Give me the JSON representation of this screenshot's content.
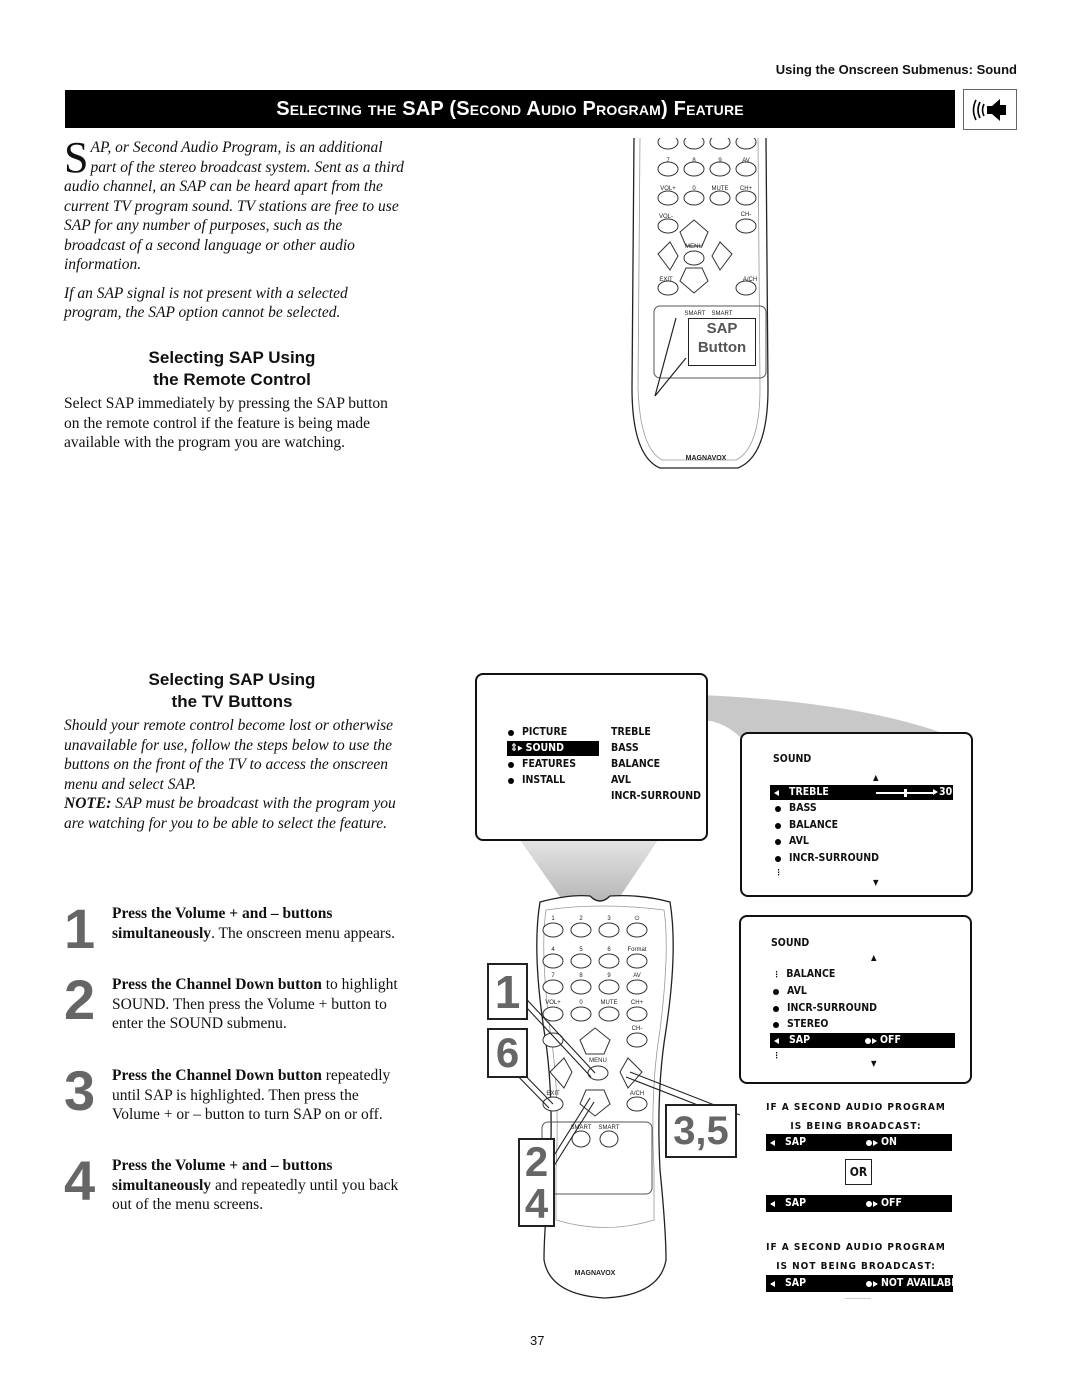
{
  "header": {
    "running_head": "Using the Onscreen Submenus: Sound",
    "title": "Selecting the SAP (Second Audio Program) Feature",
    "title_icon": "speaker-icon"
  },
  "intro": {
    "dropcap": "S",
    "paragraph1_rest": "AP, or Second Audio Program, is an additional part of the stereo broadcast system. Sent as a third audio channel, an SAP can be heard apart from the current TV program sound. TV stations are free to use SAP for any number of purposes, such as the broadcast of a second language or other audio information.",
    "paragraph2": "If an SAP signal is not present with a selected program, the SAP option cannot be selected."
  },
  "remote_section": {
    "heading_line1": "Selecting SAP Using",
    "heading_line2": "the Remote Control",
    "body": "Select SAP immediately by pressing the SAP button on the remote control if the feature is being made available with the program you are watching.",
    "callout_line1": "SAP",
    "callout_line2": "Button"
  },
  "tv_section": {
    "heading_line1": "Selecting SAP Using",
    "heading_line2": "the TV Buttons",
    "body": "Should your remote control become lost or otherwise unavailable for use, follow the steps below to use the buttons on the front of the TV to access the onscreen menu and select SAP.",
    "note_label": "NOTE:",
    "note_text": " SAP must be broadcast with the program you are watching for you to be able to select the feature."
  },
  "steps": [
    {
      "num": "1",
      "bold": "Press the Volume + and – buttons simultaneously",
      "rest": ". The onscreen menu appears."
    },
    {
      "num": "2",
      "bold": "Press the Channel Down button",
      "rest": " to highlight SOUND. Then press the Volume + button to enter the SOUND submenu."
    },
    {
      "num": "3",
      "bold": "Press the Channel Down button",
      "rest": " repeatedly until SAP is highlighted. Then press the Volume + or – button to turn SAP on or off."
    },
    {
      "num": "4",
      "bold": "Press the Volume + and – buttons simultaneously",
      "rest": " and repeatedly until you back out of the menu screens."
    }
  ],
  "main_menu": {
    "left_items": [
      "PICTURE",
      "SOUND",
      "FEATURES",
      "INSTALL"
    ],
    "highlighted": "SOUND",
    "right_items": [
      "TREBLE",
      "BASS",
      "BALANCE",
      "AVL",
      "INCR-SURROUND"
    ]
  },
  "sound_menu_1": {
    "title": "SOUND",
    "highlighted": "TREBLE",
    "treble_value": "30",
    "treble_level_fraction": 0.5,
    "items": [
      "BASS",
      "BALANCE",
      "AVL",
      "INCR-SURROUND"
    ]
  },
  "sound_menu_2": {
    "title": "SOUND",
    "items": [
      "BALANCE",
      "AVL",
      "INCR-SURROUND",
      "STEREO"
    ],
    "highlighted": "SAP",
    "highlighted_value": "OFF"
  },
  "sap_states": {
    "broadcast_line1": "IF A SECOND AUDIO PROGRAM",
    "broadcast_line2": "IS BEING BROADCAST:",
    "on_label": "SAP",
    "on_value": "ON",
    "or_label": "OR",
    "off_label": "SAP",
    "off_value": "OFF",
    "not_broadcast_line1": "IF A SECOND AUDIO PROGRAM",
    "not_broadcast_line2": "IS NOT BEING BROADCAST:",
    "na_label": "SAP",
    "na_value": "NOT AVAILABLE"
  },
  "remote": {
    "brand": "MAGNAVOX",
    "row1": [
      "1",
      "2",
      "3",
      "⏻"
    ],
    "row2": [
      "4",
      "5",
      "6",
      "Format"
    ],
    "row3": [
      "7",
      "8",
      "9",
      "AV"
    ],
    "row4": [
      "VOL+",
      "0",
      "MUTE",
      "CH+"
    ],
    "vol_minus": "VOL-",
    "ch_minus": "CH-",
    "menu": "MENU",
    "exit": "EXIT",
    "ach": "A/CH",
    "smart1": "SMART",
    "smart2": "SMART"
  },
  "callouts": {
    "c1": "1",
    "c6": "6",
    "c24_top": "2",
    "c24_bottom": "4",
    "c35": "3,5"
  },
  "footer": {
    "page_number": "37"
  }
}
